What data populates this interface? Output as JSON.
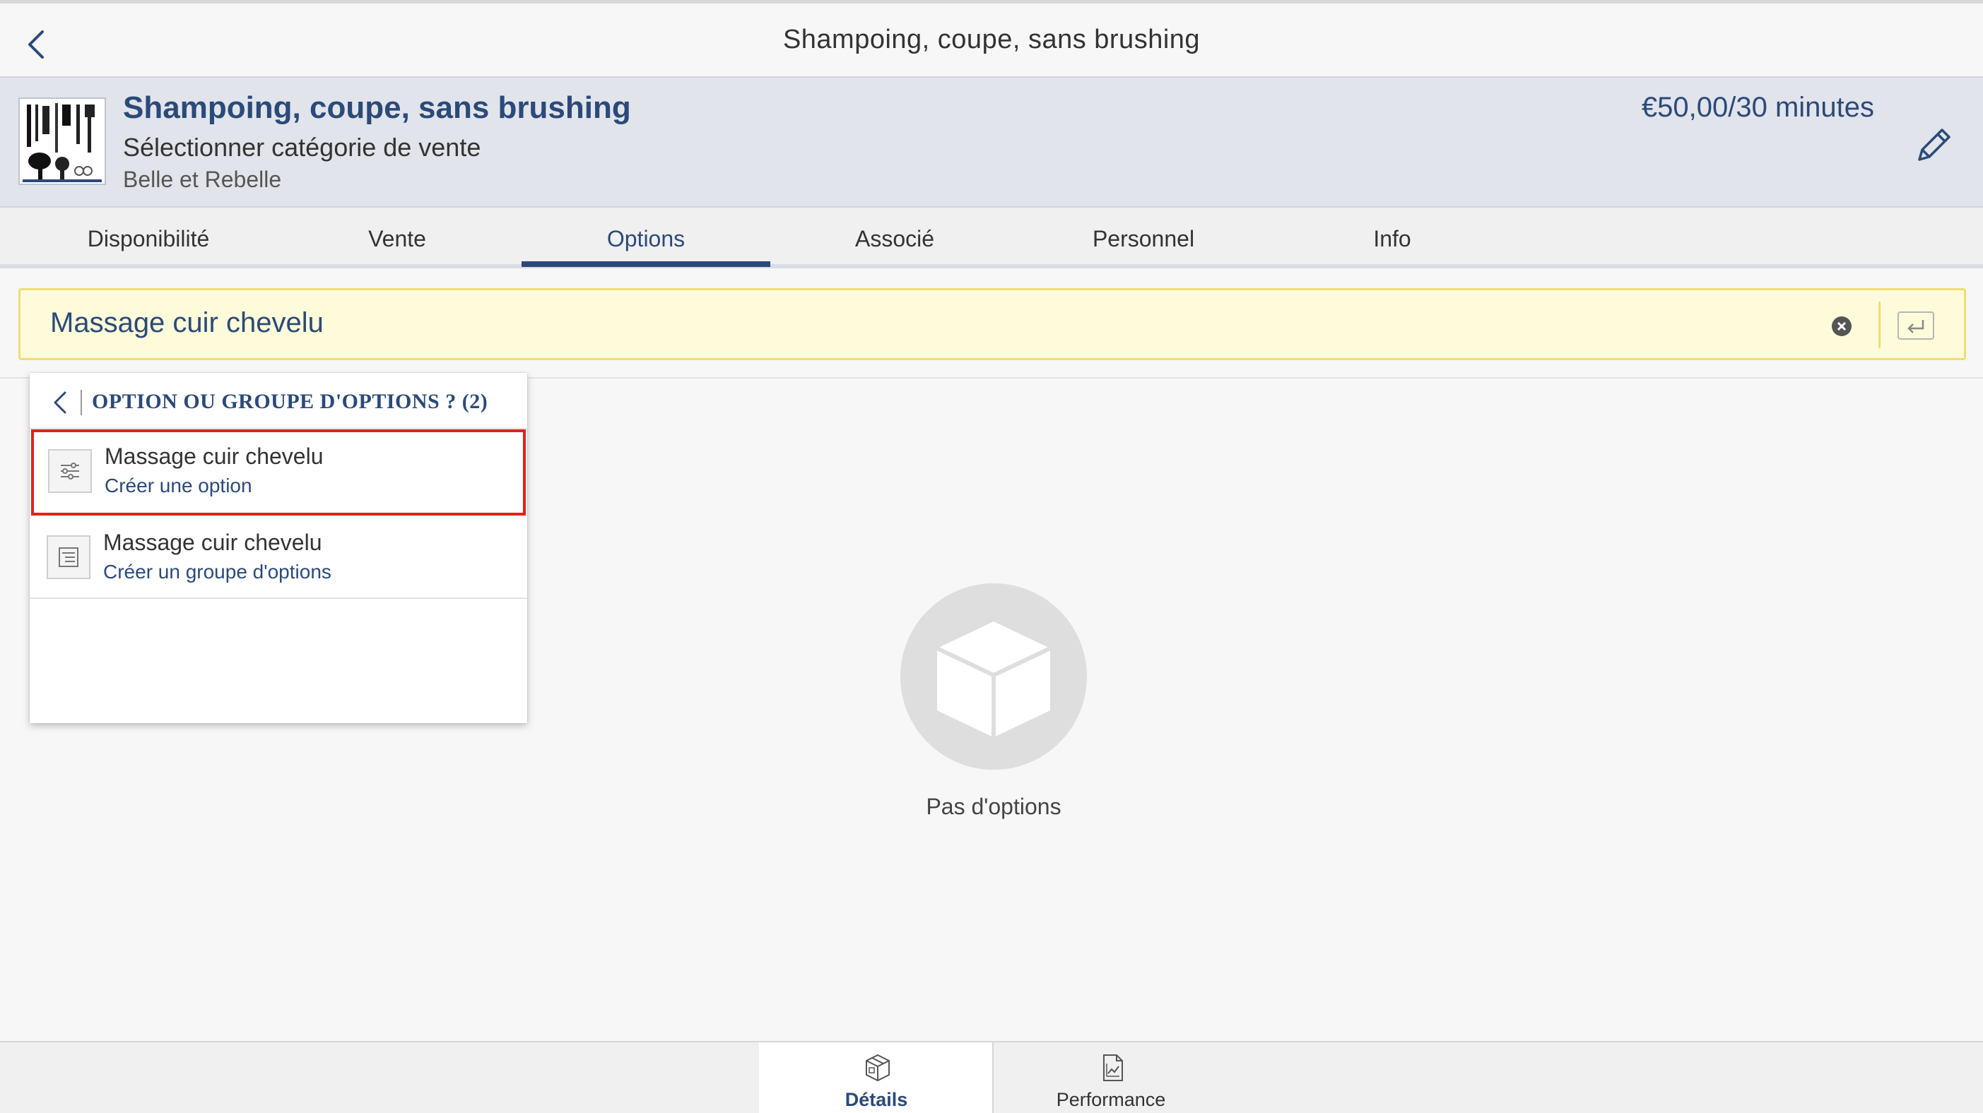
{
  "navbar": {
    "title": "Shampoing, coupe, sans brushing",
    "back_icon": "chevron-left-icon"
  },
  "header": {
    "title": "Shampoing, coupe, sans brushing",
    "category": "Sélectionner catégorie de vente",
    "location": "Belle et Rebelle",
    "price": "€50,00/30 minutes",
    "edit_icon": "pencil-icon"
  },
  "tabs": [
    {
      "label": "Disponibilité"
    },
    {
      "label": "Vente"
    },
    {
      "label": "Options"
    },
    {
      "label": "Associé"
    },
    {
      "label": "Personnel"
    },
    {
      "label": "Info"
    }
  ],
  "active_tab": "Options",
  "search": {
    "value": "Massage cuir chevelu",
    "clear_icon": "clear-icon",
    "enter_icon": "enter-icon"
  },
  "dropdown": {
    "title": "OPTION OU GROUPE D'OPTIONS ? (2)",
    "items": [
      {
        "name": "Massage cuir chevelu",
        "desc": "Créer une option",
        "icon": "sliders-icon"
      },
      {
        "name": "Massage cuir chevelu",
        "desc": "Créer un groupe d'options",
        "icon": "list-icon"
      }
    ]
  },
  "empty_state": {
    "text": "Pas d'options",
    "icon": "box-icon"
  },
  "bottom_tabs": [
    {
      "label": "Détails",
      "icon": "box-icon"
    },
    {
      "label": "Performance",
      "icon": "chart-doc-icon"
    }
  ],
  "colors": {
    "accent": "#2b4a7a",
    "header_bg": "#e1e4ea",
    "search_bg": "#fdfbd9",
    "search_border": "#f0dd76",
    "highlight": "#e2221b"
  }
}
